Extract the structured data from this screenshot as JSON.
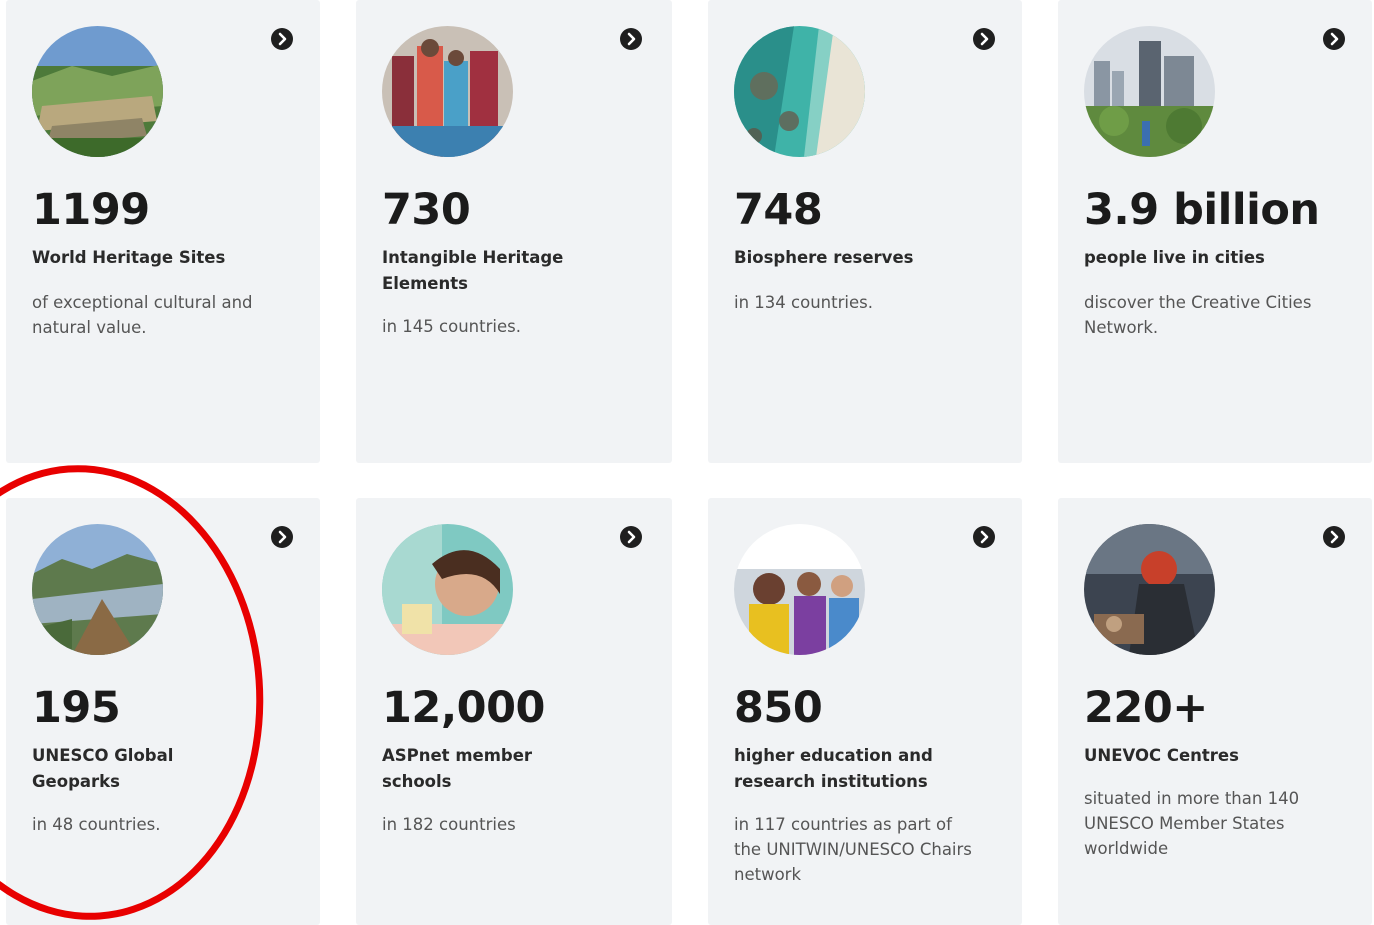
{
  "cards": [
    {
      "number": "1199",
      "label": "World Heritage Sites",
      "desc": "of exceptional cultural and natural value."
    },
    {
      "number": "730",
      "label": "Intangible Heritage Elements",
      "desc": "in 145 countries."
    },
    {
      "number": "748",
      "label": "Biosphere reserves",
      "desc": "in 134 countries."
    },
    {
      "number": "3.9 billion",
      "label": "people live in cities",
      "desc": "discover the Creative Cities Network."
    },
    {
      "number": "195",
      "label": "UNESCO Global Geoparks",
      "desc": "in 48 countries."
    },
    {
      "number": "12,000",
      "label": "ASPnet member schools",
      "desc": "in 182 countries"
    },
    {
      "number": "850",
      "label": "higher education and research institutions",
      "desc": "in 117 countries as part of the UNITWIN/UNESCO Chairs network"
    },
    {
      "number": "220+",
      "label": "UNEVOC Centres",
      "desc": "situated in more than 140 UNESCO Member States worldwide"
    }
  ],
  "icons": {
    "arrow": "arrow-right-circle-icon"
  },
  "colors": {
    "card_bg": "#f1f3f5",
    "highlight": "#e80000",
    "text": "#1b1b1b"
  }
}
